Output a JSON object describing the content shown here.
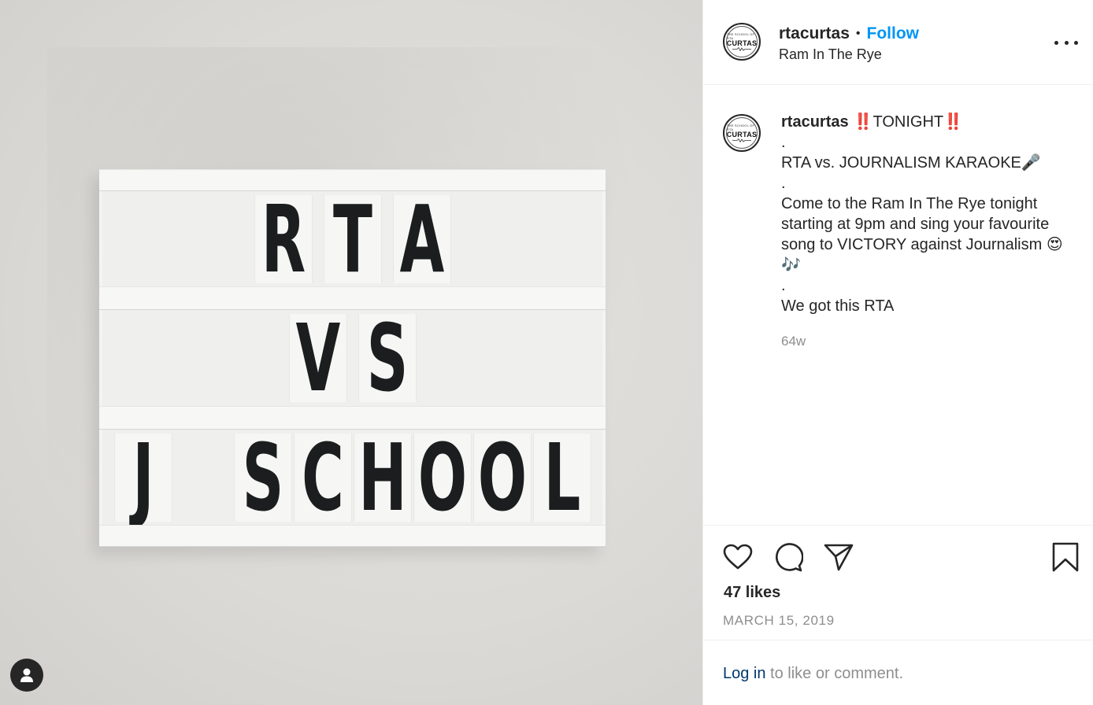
{
  "photo": {
    "sign_lines": [
      "RTA",
      "VS",
      "J SCHOOL"
    ]
  },
  "header": {
    "username": "rtacurtas",
    "separator": "•",
    "follow_label": "Follow",
    "location": "Ram In The Rye",
    "logo_text_small": "THE SCHOOL OF RTA",
    "logo_text_main": "CURTAS"
  },
  "caption": {
    "username": "rtacurtas",
    "text": "‼️TONIGHT‼️\n.\nRTA vs. JOURNALISM KARAOKE🎤\n.\nCome to the Ram In The Rye tonight starting at 9pm and sing your favourite song to VICTORY against Journalism 😍🎶\n.\nWe got this RTA",
    "timestamp": "64w"
  },
  "actions": {
    "likes": "47 likes",
    "date": "MARCH 15, 2019"
  },
  "footer": {
    "login_label": "Log in",
    "rest": " to like or comment."
  },
  "colors": {
    "follow": "#0095f6",
    "muted": "#8e8e8e",
    "login": "#00376b",
    "text": "#262626"
  }
}
